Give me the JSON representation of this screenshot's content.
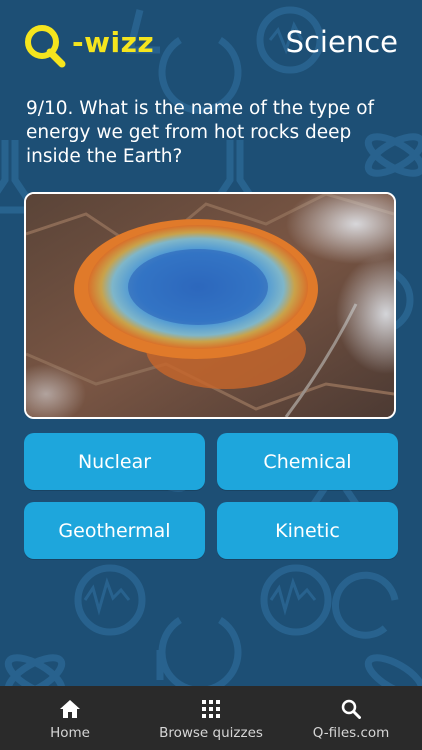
{
  "header": {
    "logo_text": "-wizz",
    "category": "Science"
  },
  "question": {
    "text": "9/10. What is the name of the type of energy we get from hot rocks deep inside the Earth?"
  },
  "answers": [
    "Nuclear",
    "Chemical",
    "Geothermal",
    "Kinetic"
  ],
  "tabs": [
    {
      "label": "Home",
      "icon": "home-icon"
    },
    {
      "label": "Browse quizzes",
      "icon": "grid-icon"
    },
    {
      "label": "Q-files.com",
      "icon": "search-icon"
    }
  ],
  "colors": {
    "background": "#1d4f75",
    "logo": "#f5e51e",
    "answer_button": "#1ea6dc",
    "tabbar": "#2a2a2a"
  }
}
